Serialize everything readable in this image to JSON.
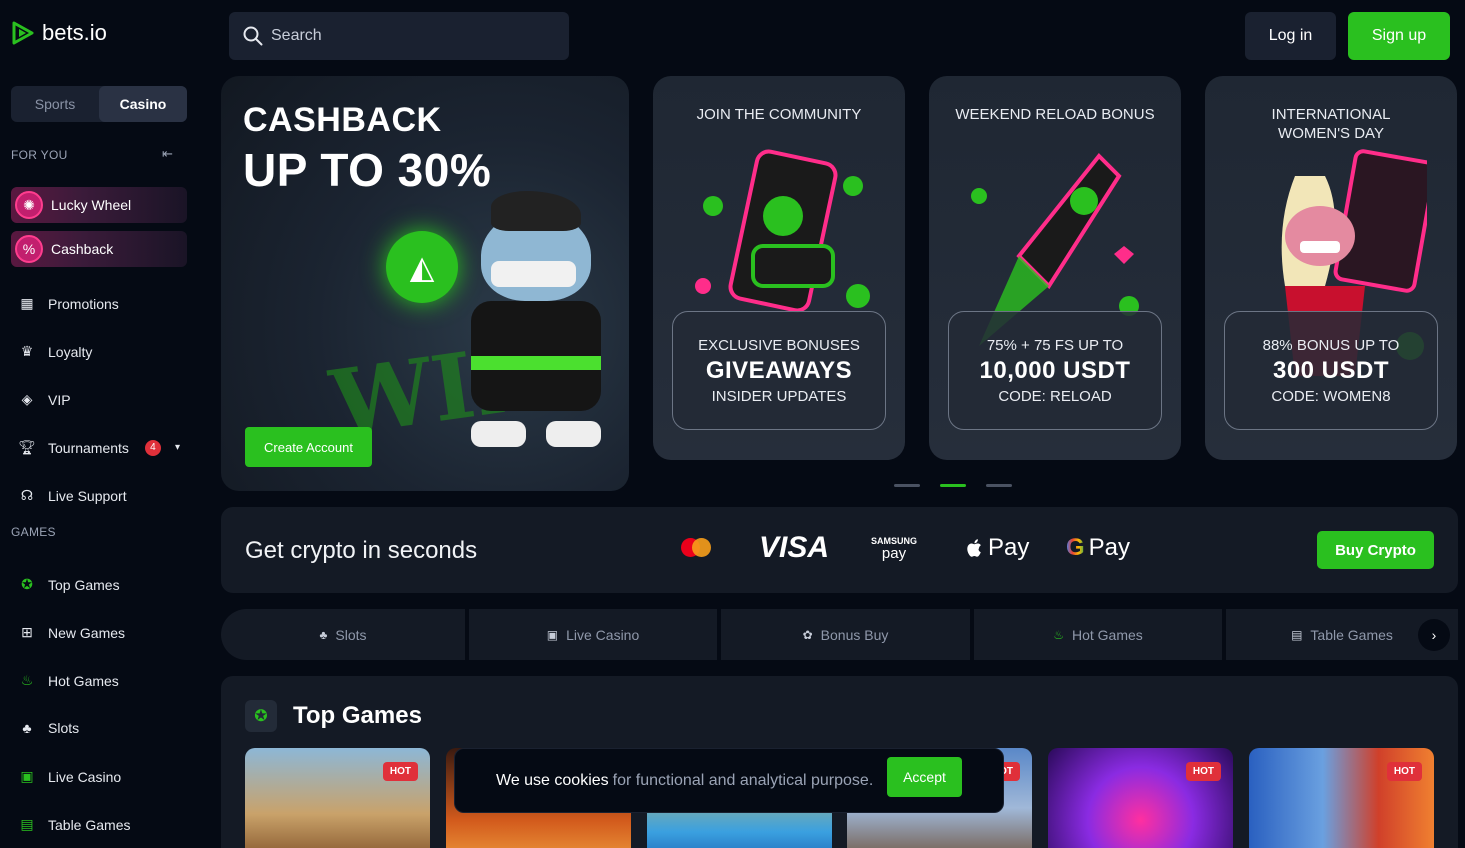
{
  "brand": {
    "name": "bets.io",
    "accent": "#2ac01f"
  },
  "sidebar": {
    "toggle": {
      "sports": "Sports",
      "casino": "Casino"
    },
    "for_you_label": "FOR YOU",
    "promos": [
      {
        "label": "Lucky Wheel",
        "icon": "wheel-icon"
      },
      {
        "label": "Cashback",
        "icon": "percent-icon"
      }
    ],
    "menu": [
      {
        "label": "Promotions",
        "icon": "gift-icon"
      },
      {
        "label": "Loyalty",
        "icon": "crown-icon"
      },
      {
        "label": "VIP",
        "icon": "diamond-icon"
      },
      {
        "label": "Tournaments",
        "icon": "trophy-icon",
        "badge": "4"
      },
      {
        "label": "Live Support",
        "icon": "headset-icon"
      }
    ],
    "games_label": "GAMES",
    "games": [
      {
        "label": "Top Games",
        "icon": "top-games-icon"
      },
      {
        "label": "New Games",
        "icon": "new-games-icon"
      },
      {
        "label": "Hot Games",
        "icon": "flame-icon"
      },
      {
        "label": "Slots",
        "icon": "cherries-icon"
      },
      {
        "label": "Live Casino",
        "icon": "live-casino-icon"
      },
      {
        "label": "Table Games",
        "icon": "table-games-icon"
      }
    ]
  },
  "header": {
    "search_placeholder": "Search",
    "login": "Log in",
    "signup": "Sign up"
  },
  "hero": {
    "main": {
      "line1": "CASHBACK",
      "line2": "UP TO 30%",
      "button": "Create Account"
    },
    "cards": [
      {
        "title": "JOIN THE COMMUNITY",
        "l1": "EXCLUSIVE BONUSES",
        "l2": "GIVEAWAYS",
        "l3": "INSIDER UPDATES"
      },
      {
        "title": "WEEKEND RELOAD BONUS",
        "l1": "75% + 75 FS UP TO",
        "l2": "10,000 USDT",
        "l3": "CODE: RELOAD"
      },
      {
        "title": "INTERNATIONAL\nWOMEN'S DAY",
        "l1": "88% BONUS UP TO",
        "l2": "300 USDT",
        "l3": "CODE: WOMEN8"
      }
    ]
  },
  "crypto": {
    "text": "Get crypto in seconds",
    "visa": "VISA",
    "samsung_top": "SAMSUNG",
    "samsung_bottom": "pay",
    "apple_pay": "Pay",
    "google_pay": "Pay",
    "button": "Buy Crypto"
  },
  "categories": [
    {
      "label": "Slots",
      "icon": "cherries-icon"
    },
    {
      "label": "Live Casino",
      "icon": "live-casino-icon"
    },
    {
      "label": "Bonus Buy",
      "icon": "bonus-buy-icon"
    },
    {
      "label": "Hot Games",
      "icon": "flame-icon"
    },
    {
      "label": "Table Games",
      "icon": "table-games-icon"
    }
  ],
  "top_games": {
    "title": "Top Games",
    "hot_label": "HOT"
  },
  "cookie": {
    "text_bold": "We use cookies",
    "text_rest": "for functional and analytical purpose.",
    "accept": "Accept"
  }
}
